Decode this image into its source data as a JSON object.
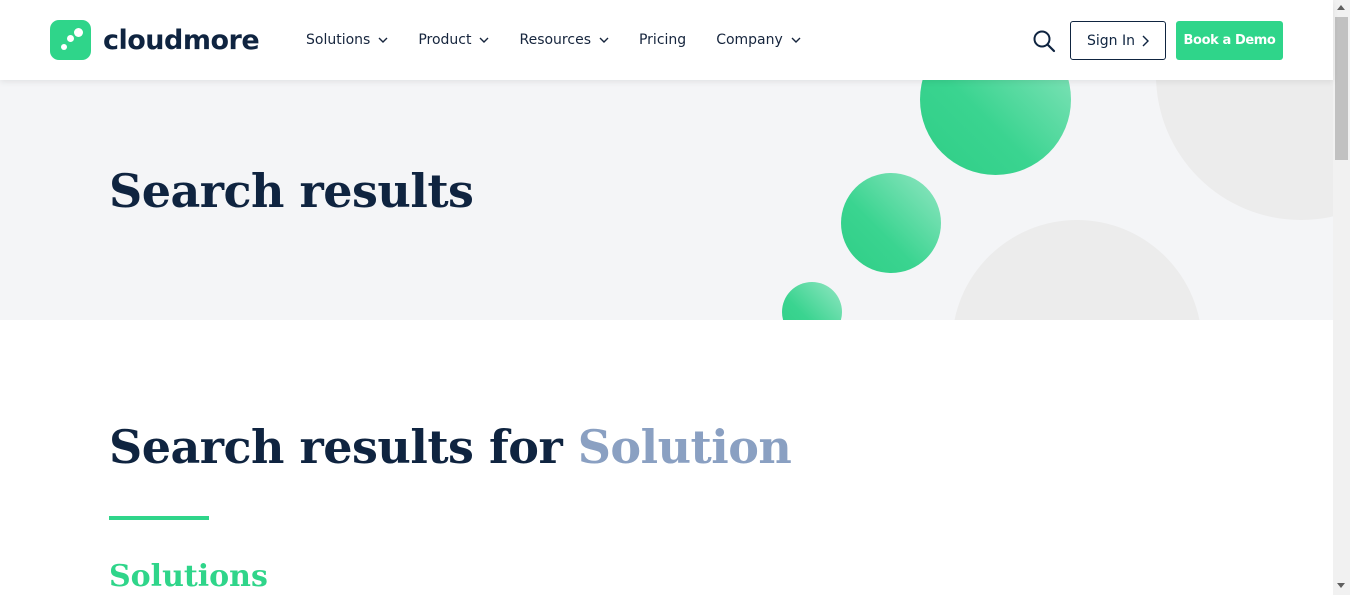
{
  "brand": {
    "name": "cloudmore",
    "color": "#2fd58a",
    "icon": "cloudmore-logo-icon"
  },
  "nav": {
    "items": [
      {
        "label": "Solutions",
        "has_dropdown": true
      },
      {
        "label": "Product",
        "has_dropdown": true
      },
      {
        "label": "Resources",
        "has_dropdown": true
      },
      {
        "label": "Pricing",
        "has_dropdown": false
      },
      {
        "label": "Company",
        "has_dropdown": true
      }
    ]
  },
  "header": {
    "search_icon": "search-icon",
    "sign_in_label": "Sign In",
    "book_demo_label": "Book a Demo"
  },
  "hero": {
    "title": "Search results"
  },
  "results": {
    "prefix": "Search results for",
    "term": "Solution",
    "term_color": "#8aa0c2",
    "section_heading": "Solutions"
  },
  "colors": {
    "navy": "#0f2440",
    "accent": "#2fd58a",
    "hero_bg": "#f4f5f7"
  }
}
